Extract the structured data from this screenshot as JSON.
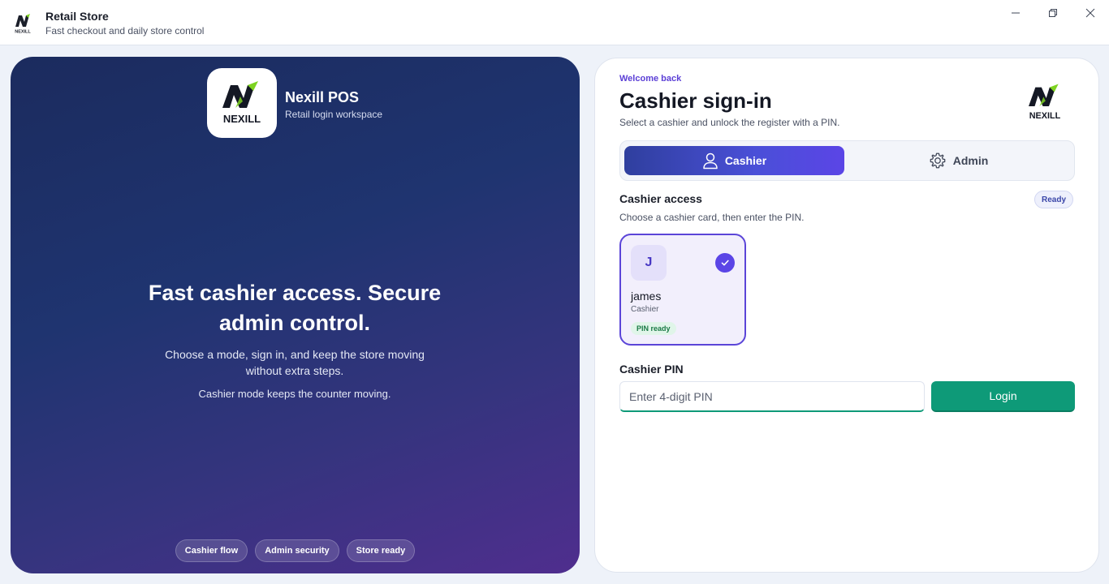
{
  "window": {
    "title": "Retail Store",
    "subtitle": "Fast checkout and daily store control",
    "logo_icon": "nexill-logo-icon",
    "controls": [
      "minimize-icon",
      "maximize-icon",
      "close-icon"
    ]
  },
  "hero": {
    "brand_name": "Nexill POS",
    "brand_subtitle": "Retail login workspace",
    "logo_text": "NEXILL",
    "headline": "Fast cashier access. Secure admin control.",
    "description": "Choose a mode, sign in, and keep the store moving without extra steps.",
    "note": "Cashier mode keeps the counter moving.",
    "chips": [
      "Cashier flow",
      "Admin security",
      "Store ready"
    ]
  },
  "signin": {
    "eyebrow": "Welcome back",
    "title": "Cashier sign-in",
    "subtitle": "Select a cashier and unlock the register with a PIN.",
    "logo_text": "NEXILL",
    "tabs": [
      {
        "label": "Cashier",
        "icon": "user-icon",
        "active": true
      },
      {
        "label": "Admin",
        "icon": "gear-icon",
        "active": false
      }
    ],
    "section": {
      "title": "Cashier access",
      "subtitle": "Choose a cashier card, then enter the PIN.",
      "status": "Ready"
    },
    "cashiers": [
      {
        "initial": "J",
        "name": "james",
        "role": "Cashier",
        "pin_status": "PIN ready",
        "selected": true
      }
    ],
    "pin": {
      "label": "Cashier PIN",
      "value": "",
      "placeholder": "Enter 4-digit PIN"
    },
    "login_label": "Login"
  },
  "colors": {
    "accent": "#5b45e6",
    "primary_action": "#0e9a78",
    "hero_start": "#1b2b5e",
    "hero_end": "#4f2e8e",
    "brand_green": "#7ed321"
  }
}
